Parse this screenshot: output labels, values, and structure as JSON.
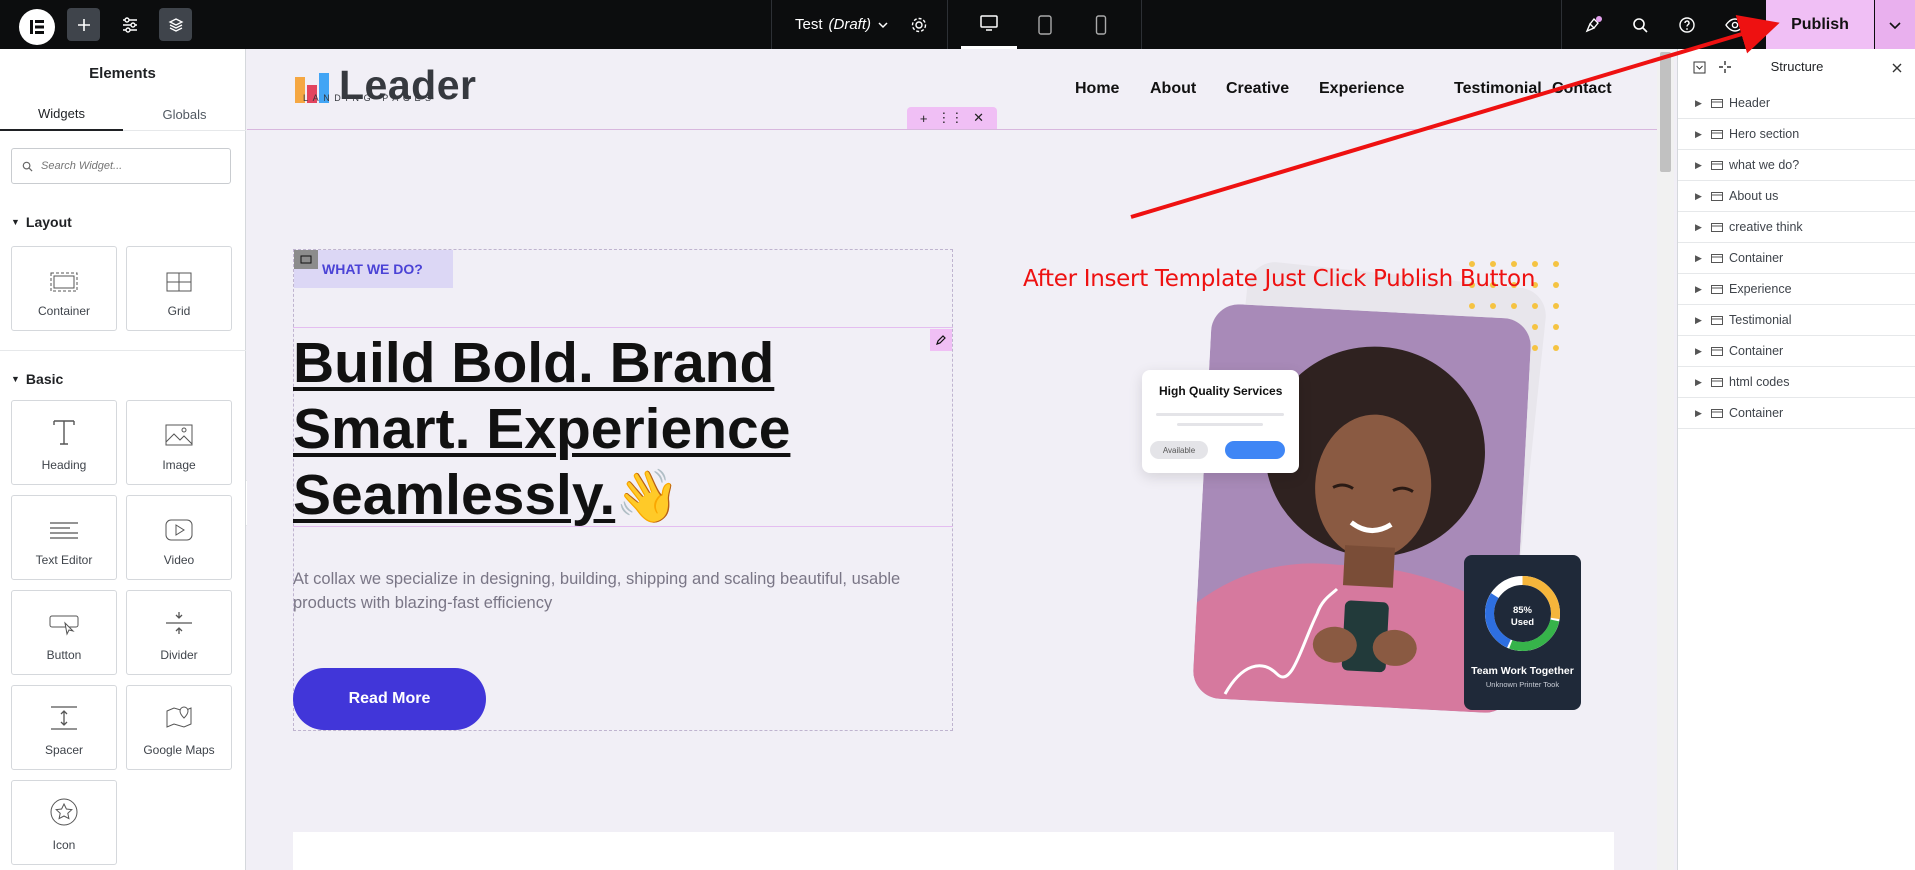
{
  "topbar": {
    "doc_name": "Test",
    "doc_status": "(Draft)",
    "publish_label": "Publish"
  },
  "left_panel": {
    "title": "Elements",
    "tabs": [
      "Widgets",
      "Globals"
    ],
    "search_placeholder": "Search Widget...",
    "categories": {
      "layout": {
        "label": "Layout",
        "widgets": [
          "Container",
          "Grid"
        ]
      },
      "basic": {
        "label": "Basic",
        "widgets": [
          "Heading",
          "Image",
          "Text Editor",
          "Video",
          "Button",
          "Divider",
          "Spacer",
          "Google Maps",
          "Icon"
        ]
      }
    }
  },
  "site": {
    "brand_name": "Leader",
    "brand_sub": "LANDING PAGES",
    "nav": [
      "Home",
      "About",
      "Creative",
      "Experience",
      "Testimonial",
      "Contact"
    ],
    "annotation": "After Insert Template Just Click Publish Button",
    "hero": {
      "tag": "WHAT WE DO?",
      "headline": "Build Bold. Brand Smart. Experience Seamlessly.",
      "emoji": "👋",
      "description": "At collax we specialize in designing, building, shipping and scaling beautiful, usable products with blazing-fast efficiency",
      "cta": "Read More"
    },
    "card_quality": {
      "title": "High Quality Services",
      "badge": "Available"
    },
    "card_team": {
      "percent_label": "85%",
      "used_label": "Used",
      "title": "Team Work Together",
      "subtitle": "Unknown Printer Took",
      "progress": 0.85
    }
  },
  "structure": {
    "title": "Structure",
    "items": [
      "Header",
      "Hero section",
      "what we do?",
      "About us",
      "creative think",
      "Container",
      "Experience",
      "Testimonial",
      "Container",
      "html codes",
      "Container"
    ]
  },
  "colors": {
    "accent": "#4136d9",
    "publish": "#f0bff5",
    "annotation": "#ee1111"
  }
}
